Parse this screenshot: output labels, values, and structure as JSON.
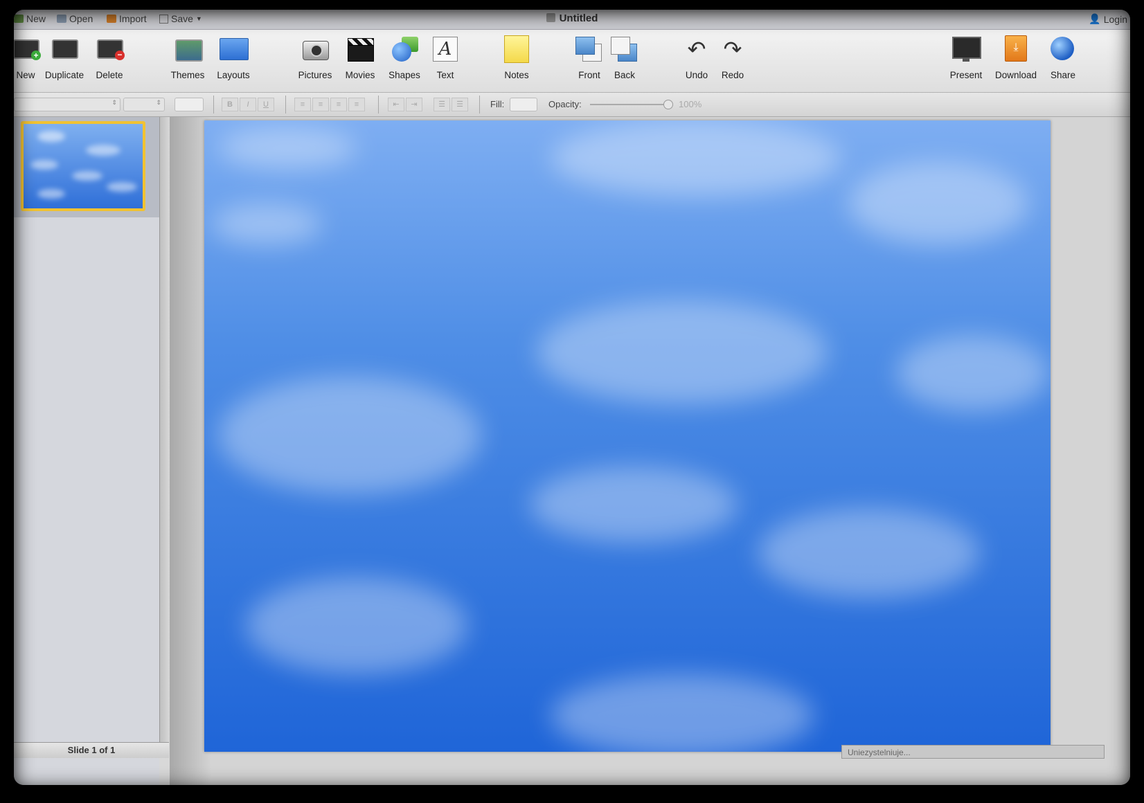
{
  "menubar": {
    "items": [
      {
        "label": "New",
        "icon": "new-doc-icon"
      },
      {
        "label": "Open",
        "icon": "folder-icon"
      },
      {
        "label": "Import",
        "icon": "import-icon"
      },
      {
        "label": "Save",
        "icon": "save-icon"
      }
    ],
    "title": "Untitled",
    "login": "Login"
  },
  "toolbar": {
    "new": "New",
    "duplicate": "Duplicate",
    "delete": "Delete",
    "themes": "Themes",
    "layouts": "Layouts",
    "pictures": "Pictures",
    "movies": "Movies",
    "shapes": "Shapes",
    "text": "Text",
    "notes": "Notes",
    "front": "Front",
    "back": "Back",
    "undo": "Undo",
    "redo": "Redo",
    "present": "Present",
    "download": "Download",
    "share": "Share"
  },
  "formatbar": {
    "fill_label": "Fill:",
    "opacity_label": "Opacity:",
    "opacity_value": "100%"
  },
  "sidebar": {
    "slide_counter": "Slide 1 of 1"
  },
  "status": {
    "tip": "Uniezystelniuje..."
  },
  "colors": {
    "accent_selection": "#f1c232",
    "sky_top": "#7eaef2",
    "sky_bottom": "#1f65d8"
  }
}
